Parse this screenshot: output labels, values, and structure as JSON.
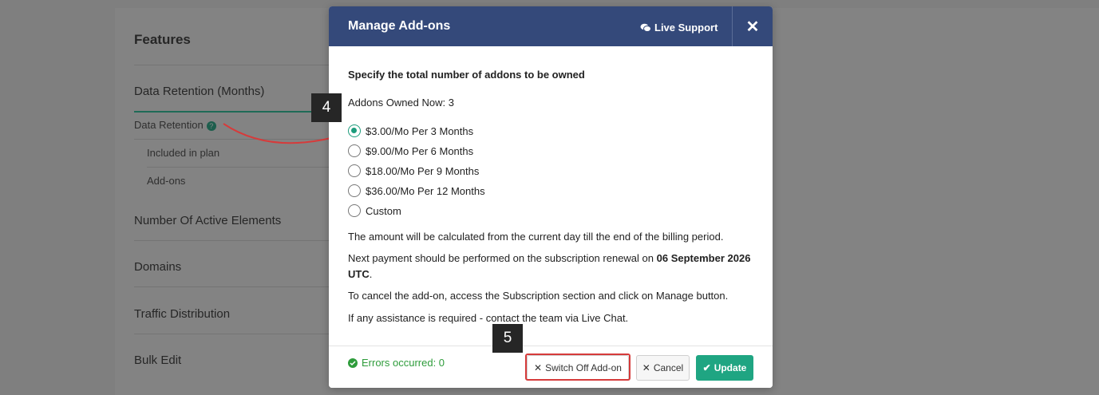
{
  "background": {
    "title": "Features",
    "sections": [
      "Data Retention (Months)",
      "Number Of Active Elements",
      "Domains",
      "Traffic Distribution",
      "Bulk Edit"
    ],
    "data_retention": {
      "label": "Data Retention",
      "help_glyph": "?",
      "items": [
        "Included in plan",
        "Add-ons"
      ]
    }
  },
  "modal": {
    "title": "Manage Add-ons",
    "live_support": "Live Support",
    "close_glyph": "✕",
    "heading": "Specify the total number of addons to be owned",
    "owned_now": "Addons Owned Now: 3",
    "options": [
      {
        "label": "$3.00/Mo Per 3 Months",
        "checked": true
      },
      {
        "label": "$9.00/Mo Per 6 Months",
        "checked": false
      },
      {
        "label": "$18.00/Mo Per 9 Months",
        "checked": false
      },
      {
        "label": "$36.00/Mo Per 12 Months",
        "checked": false
      },
      {
        "label": "Custom",
        "checked": false
      }
    ],
    "note_amount": "The amount will be calculated from the current day till the end of the billing period.",
    "note_next_payment_prefix": "Next payment should be performed on the subscription renewal on ",
    "note_next_payment_date": "06 September 2026 UTC",
    "note_next_payment_suffix": ".",
    "note_cancel": "To cancel the add-on, access the Subscription section and click on Manage button.",
    "note_assistance": "If any assistance is required - contact the team via Live Chat.",
    "footer": {
      "errors": "Errors occurred: 0",
      "switch_off": "Switch Off Add-on",
      "cancel": "Cancel",
      "update": "Update"
    }
  },
  "steps": {
    "step4": "4",
    "step5": "5"
  },
  "colors": {
    "header": "#34497a",
    "accent": "#1fa582",
    "highlight": "#d63b3b",
    "success": "#2e9c3b"
  }
}
